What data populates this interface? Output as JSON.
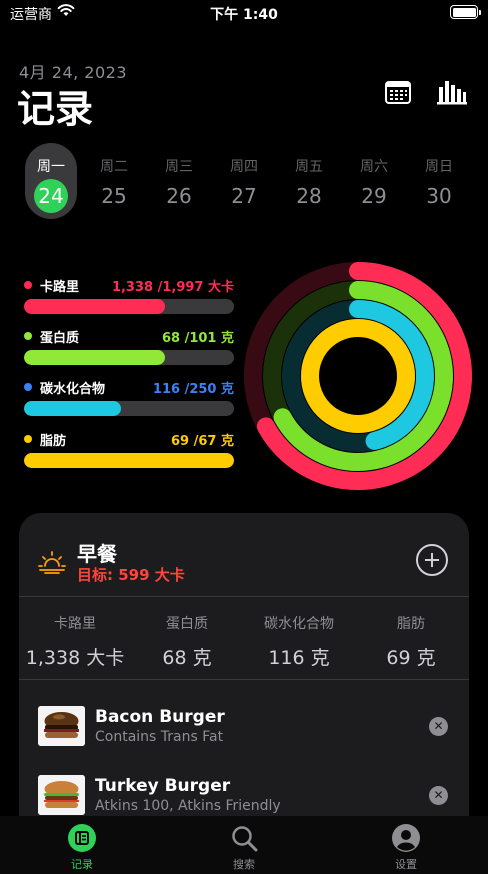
{
  "status_bar": {
    "carrier": "运营商",
    "time": "下午 1:40"
  },
  "header": {
    "date": "4月 24, 2023",
    "title": "记录",
    "icons": [
      "calendar-icon",
      "chart-bar-icon"
    ]
  },
  "week": {
    "days": [
      {
        "name": "周一",
        "num": "24",
        "selected": true
      },
      {
        "name": "周二",
        "num": "25"
      },
      {
        "name": "周三",
        "num": "26"
      },
      {
        "name": "周四",
        "num": "27"
      },
      {
        "name": "周五",
        "num": "28"
      },
      {
        "name": "周六",
        "num": "29"
      },
      {
        "name": "周日",
        "num": "30"
      }
    ],
    "selected_color": "#30d158"
  },
  "macros": [
    {
      "name": "卡路里",
      "value": "1,338 /1,997 大卡",
      "color": "#ff2d55",
      "progress": 0.67
    },
    {
      "name": "蛋白质",
      "value": "68 /101 克",
      "color": "#92e838",
      "progress": 0.67
    },
    {
      "name": "碳水化合物",
      "value": "116 /250 克",
      "color": "#3b82f6",
      "progress": 0.46
    },
    {
      "name": "脂肪",
      "value": "69 /67 克",
      "color": "#ffcc00",
      "progress": 1.0
    }
  ],
  "rings": [
    {
      "name": "calories-ring",
      "progress": 0.67,
      "color": "#ff2d55"
    },
    {
      "name": "protein-ring",
      "progress": 0.67,
      "color": "#7be02c"
    },
    {
      "name": "carbs-ring",
      "progress": 0.46,
      "color": "#1ec8e0"
    },
    {
      "name": "fat-ring",
      "progress": 1.0,
      "color": "#ffcc00"
    }
  ],
  "meal": {
    "title": "早餐",
    "target": "目标: 599 大卡",
    "summary": [
      {
        "label": "卡路里",
        "value": "1,338 大卡"
      },
      {
        "label": "蛋白质",
        "value": "68 克"
      },
      {
        "label": "碳水化合物",
        "value": "116 克"
      },
      {
        "label": "脂肪",
        "value": "69 克"
      }
    ],
    "foods": [
      {
        "name": "Bacon Burger",
        "desc": "Contains Trans Fat"
      },
      {
        "name": "Turkey Burger",
        "desc": "Atkins 100, Atkins Friendly"
      }
    ]
  },
  "tabs": [
    {
      "label": "记录",
      "active": true
    },
    {
      "label": "搜索"
    },
    {
      "label": "设置"
    }
  ],
  "colors": {
    "accent": "#30d158",
    "target_red": "#ff453a",
    "card_bg": "#1c1c1e"
  }
}
